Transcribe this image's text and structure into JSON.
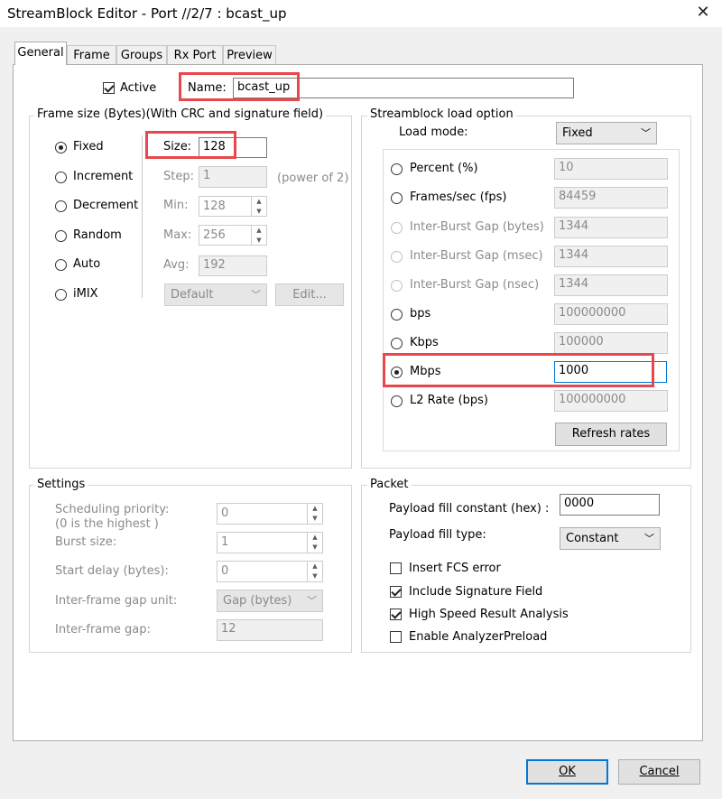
{
  "window": {
    "title": "StreamBlock Editor - Port //2/7 : bcast_up",
    "close_glyph": "✕"
  },
  "tabs": [
    "General",
    "Frame",
    "Groups",
    "Rx Port",
    "Preview"
  ],
  "header": {
    "active_label": "Active",
    "active_checked": true,
    "name_label": "Name:",
    "name_value": "bcast_up"
  },
  "frame_size": {
    "title": "Frame size (Bytes)(With CRC and signature field)",
    "modes": [
      "Fixed",
      "Increment",
      "Decrement",
      "Random",
      "Auto",
      "iMIX"
    ],
    "selected": "Fixed",
    "size_label": "Size:",
    "size_value": "128",
    "step_label": "Step:",
    "step_value": "1",
    "step_note": "(power of 2)",
    "min_label": "Min:",
    "min_value": "128",
    "max_label": "Max:",
    "max_value": "256",
    "avg_label": "Avg:",
    "avg_value": "192",
    "imix_value": "Default",
    "edit_label": "Edit..."
  },
  "load": {
    "title": "Streamblock load option",
    "mode_label": "Load mode:",
    "mode_value": "Fixed",
    "options": [
      {
        "label": "Percent (%)",
        "value": "10",
        "enabled": true,
        "selected": false
      },
      {
        "label": "Frames/sec (fps)",
        "value": "84459",
        "enabled": true,
        "selected": false
      },
      {
        "label": "Inter-Burst Gap (bytes)",
        "value": "1344",
        "enabled": false,
        "selected": false
      },
      {
        "label": "Inter-Burst Gap (msec)",
        "value": "1344",
        "enabled": false,
        "selected": false
      },
      {
        "label": "Inter-Burst Gap (nsec)",
        "value": "1344",
        "enabled": false,
        "selected": false
      },
      {
        "label": "bps",
        "value": "100000000",
        "enabled": true,
        "selected": false
      },
      {
        "label": "Kbps",
        "value": "100000",
        "enabled": true,
        "selected": false
      },
      {
        "label": "Mbps",
        "value": "1000",
        "enabled": true,
        "selected": true
      },
      {
        "label": "L2 Rate (bps)",
        "value": "100000000",
        "enabled": true,
        "selected": false
      }
    ],
    "refresh_label": "Refresh rates"
  },
  "settings": {
    "title": "Settings",
    "priority_label": "Scheduling priority:",
    "priority_note": "(0 is the highest )",
    "priority_value": "0",
    "burst_label": "Burst size:",
    "burst_value": "1",
    "delay_label": "Start delay (bytes):",
    "delay_value": "0",
    "gap_unit_label": "Inter-frame gap unit:",
    "gap_unit_value": "Gap (bytes)",
    "gap_label": "Inter-frame gap:",
    "gap_value": "12"
  },
  "packet": {
    "title": "Packet",
    "fill_const_label": "Payload fill constant (hex) :",
    "fill_const_value": "0000",
    "fill_type_label": "Payload fill type:",
    "fill_type_value": "Constant",
    "checks": [
      {
        "label": "Insert FCS error",
        "checked": false
      },
      {
        "label": "Include Signature Field",
        "checked": true
      },
      {
        "label": "High Speed Result Analysis",
        "checked": true
      },
      {
        "label": "Enable AnalyzerPreload",
        "checked": false
      }
    ]
  },
  "footer": {
    "ok_label": "OK",
    "cancel_label": "Cancel"
  },
  "colors": {
    "highlight": "#e8474c",
    "focus": "#0078d7",
    "panel": "#ffffff",
    "window": "#f0f0f0"
  }
}
